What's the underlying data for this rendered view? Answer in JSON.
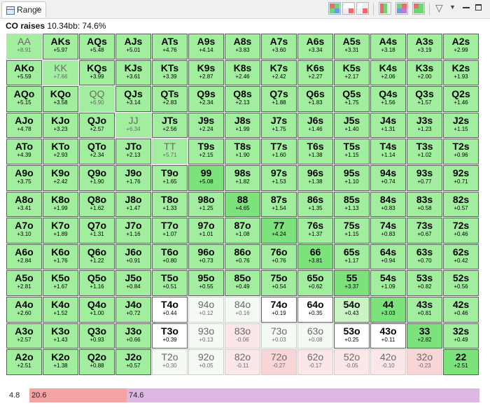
{
  "tab": {
    "label": "Range",
    "close": "×"
  },
  "toolbar": {
    "icons": [
      "layout-grid-icon",
      "layout-split-icon",
      "layout-quad-icon",
      "chart-color-icon",
      "heatmap-icon",
      "table-grid-icon"
    ],
    "filter_icon": "filter-icon"
  },
  "caption": {
    "prefix": "CO raises",
    "detail": "10.34bb: 74.6%"
  },
  "colors": {
    "green_strong": "#7ce37c",
    "green": "#a0ee9e",
    "green_light": "#c9f5c5",
    "pale": "#f3fbf2",
    "white": "#ffffff",
    "pink_light": "#fbe7e7",
    "pink": "#f8d6d6"
  },
  "matrix": [
    [
      [
        "AA",
        "+8.91",
        "g2",
        1
      ],
      [
        "AKs",
        "+5.97",
        "g2",
        0
      ],
      [
        "AQs",
        "+5.48",
        "g2",
        0
      ],
      [
        "AJs",
        "+5.01",
        "g2",
        0
      ],
      [
        "ATs",
        "+4.76",
        "g2",
        0
      ],
      [
        "A9s",
        "+4.14",
        "g2",
        0
      ],
      [
        "A8s",
        "+3.83",
        "g2",
        0
      ],
      [
        "A7s",
        "+3.60",
        "g2",
        0
      ],
      [
        "A6s",
        "+3.34",
        "g2",
        0
      ],
      [
        "A5s",
        "+3.31",
        "g2",
        0
      ],
      [
        "A4s",
        "+3.18",
        "g2",
        0
      ],
      [
        "A3s",
        "+3.19",
        "g2",
        0
      ],
      [
        "A2s",
        "+2.99",
        "g2",
        0
      ]
    ],
    [
      [
        "AKo",
        "+5.59",
        "g2",
        0
      ],
      [
        "KK",
        "+7.66",
        "g2",
        1
      ],
      [
        "KQs",
        "+3.99",
        "g2",
        0
      ],
      [
        "KJs",
        "+3.61",
        "g2",
        0
      ],
      [
        "KTs",
        "+3.39",
        "g2",
        0
      ],
      [
        "K9s",
        "+2.87",
        "g2",
        0
      ],
      [
        "K8s",
        "+2.46",
        "g2",
        0
      ],
      [
        "K7s",
        "+2.42",
        "g2",
        0
      ],
      [
        "K6s",
        "+2.27",
        "g2",
        0
      ],
      [
        "K5s",
        "+2.17",
        "g2",
        0
      ],
      [
        "K4s",
        "+2.06",
        "g2",
        0
      ],
      [
        "K3s",
        "+2.00",
        "g2",
        0
      ],
      [
        "K2s",
        "+1.93",
        "g2",
        0
      ]
    ],
    [
      [
        "AQo",
        "+5.15",
        "g2",
        0
      ],
      [
        "KQo",
        "+3.58",
        "g2",
        0
      ],
      [
        "QQ",
        "+6.90",
        "g2",
        1
      ],
      [
        "QJs",
        "+3.14",
        "g2",
        0
      ],
      [
        "QTs",
        "+2.83",
        "g2",
        0
      ],
      [
        "Q9s",
        "+2.34",
        "g2",
        0
      ],
      [
        "Q8s",
        "+2.13",
        "g2",
        0
      ],
      [
        "Q7s",
        "+1.88",
        "g2",
        0
      ],
      [
        "Q6s",
        "+1.83",
        "g2",
        0
      ],
      [
        "Q5s",
        "+1.75",
        "g2",
        0
      ],
      [
        "Q4s",
        "+1.56",
        "g2",
        0
      ],
      [
        "Q3s",
        "+1.57",
        "g2",
        0
      ],
      [
        "Q2s",
        "+1.46",
        "g2",
        0
      ]
    ],
    [
      [
        "AJo",
        "+4.78",
        "g2",
        0
      ],
      [
        "KJo",
        "+3.23",
        "g2",
        0
      ],
      [
        "QJo",
        "+2.57",
        "g2",
        0
      ],
      [
        "JJ",
        "+6.34",
        "g2",
        1
      ],
      [
        "JTs",
        "+2.56",
        "g2",
        0
      ],
      [
        "J9s",
        "+2.24",
        "g2",
        0
      ],
      [
        "J8s",
        "+1.99",
        "g2",
        0
      ],
      [
        "J7s",
        "+1.75",
        "g2",
        0
      ],
      [
        "J6s",
        "+1.46",
        "g2",
        0
      ],
      [
        "J5s",
        "+1.40",
        "g2",
        0
      ],
      [
        "J4s",
        "+1.31",
        "g2",
        0
      ],
      [
        "J3s",
        "+1.23",
        "g2",
        0
      ],
      [
        "J2s",
        "+1.15",
        "g2",
        0
      ]
    ],
    [
      [
        "ATo",
        "+4.39",
        "g2",
        0
      ],
      [
        "KTo",
        "+2.93",
        "g2",
        0
      ],
      [
        "QTo",
        "+2.34",
        "g2",
        0
      ],
      [
        "JTo",
        "+2.13",
        "g2",
        0
      ],
      [
        "TT",
        "+5.71",
        "g2",
        1
      ],
      [
        "T9s",
        "+2.15",
        "g2",
        0
      ],
      [
        "T8s",
        "+1.90",
        "g2",
        0
      ],
      [
        "T7s",
        "+1.60",
        "g2",
        0
      ],
      [
        "T6s",
        "+1.38",
        "g2",
        0
      ],
      [
        "T5s",
        "+1.15",
        "g2",
        0
      ],
      [
        "T4s",
        "+1.14",
        "g2",
        0
      ],
      [
        "T3s",
        "+1.02",
        "g2",
        0
      ],
      [
        "T2s",
        "+0.96",
        "g2",
        0
      ]
    ],
    [
      [
        "A9o",
        "+3.75",
        "g2",
        0
      ],
      [
        "K9o",
        "+2.42",
        "g2",
        0
      ],
      [
        "Q9o",
        "+1.90",
        "g2",
        0
      ],
      [
        "J9o",
        "+1.76",
        "g2",
        0
      ],
      [
        "T9o",
        "+1.65",
        "g2",
        0
      ],
      [
        "99",
        "+5.08",
        "g1",
        0
      ],
      [
        "98s",
        "+1.82",
        "g2",
        0
      ],
      [
        "97s",
        "+1.53",
        "g2",
        0
      ],
      [
        "96s",
        "+1.38",
        "g2",
        0
      ],
      [
        "95s",
        "+1.10",
        "g2",
        0
      ],
      [
        "94s",
        "+0.74",
        "g2",
        0
      ],
      [
        "93s",
        "+0.77",
        "g2",
        0
      ],
      [
        "92s",
        "+0.71",
        "g2",
        0
      ]
    ],
    [
      [
        "A8o",
        "+3.41",
        "g2",
        0
      ],
      [
        "K8o",
        "+1.99",
        "g2",
        0
      ],
      [
        "Q8o",
        "+1.62",
        "g2",
        0
      ],
      [
        "J8o",
        "+1.47",
        "g2",
        0
      ],
      [
        "T8o",
        "+1.33",
        "g2",
        0
      ],
      [
        "98o",
        "+1.25",
        "g2",
        0
      ],
      [
        "88",
        "+4.65",
        "g1",
        0
      ],
      [
        "87s",
        "+1.54",
        "g2",
        0
      ],
      [
        "86s",
        "+1.35",
        "g2",
        0
      ],
      [
        "85s",
        "+1.13",
        "g2",
        0
      ],
      [
        "84s",
        "+0.83",
        "g2",
        0
      ],
      [
        "83s",
        "+0.58",
        "g2",
        0
      ],
      [
        "82s",
        "+0.57",
        "g2",
        0
      ]
    ],
    [
      [
        "A7o",
        "+3.10",
        "g2",
        0
      ],
      [
        "K7o",
        "+1.89",
        "g2",
        0
      ],
      [
        "Q7o",
        "+1.31",
        "g2",
        0
      ],
      [
        "J7o",
        "+1.16",
        "g2",
        0
      ],
      [
        "T7o",
        "+1.07",
        "g2",
        0
      ],
      [
        "97o",
        "+1.01",
        "g2",
        0
      ],
      [
        "87o",
        "+1.08",
        "g2",
        0
      ],
      [
        "77",
        "+4.24",
        "g1",
        0
      ],
      [
        "76s",
        "+1.37",
        "g2",
        0
      ],
      [
        "75s",
        "+1.15",
        "g2",
        0
      ],
      [
        "74s",
        "+0.83",
        "g2",
        0
      ],
      [
        "73s",
        "+0.67",
        "g2",
        0
      ],
      [
        "72s",
        "+0.46",
        "g2",
        0
      ]
    ],
    [
      [
        "A6o",
        "+2.84",
        "g2",
        0
      ],
      [
        "K6o",
        "+1.76",
        "g2",
        0
      ],
      [
        "Q6o",
        "+1.22",
        "g2",
        0
      ],
      [
        "J6o",
        "+0.91",
        "g2",
        0
      ],
      [
        "T6o",
        "+0.80",
        "g2",
        0
      ],
      [
        "96o",
        "+0.73",
        "g2",
        0
      ],
      [
        "86o",
        "+0.76",
        "g2",
        0
      ],
      [
        "76o",
        "+0.76",
        "g2",
        0
      ],
      [
        "66",
        "+3.81",
        "g1",
        0
      ],
      [
        "65s",
        "+1.17",
        "g2",
        0
      ],
      [
        "64s",
        "+0.94",
        "g2",
        0
      ],
      [
        "63s",
        "+0.70",
        "g2",
        0
      ],
      [
        "62s",
        "+0.42",
        "g2",
        0
      ]
    ],
    [
      [
        "A5o",
        "+2.81",
        "g2",
        0
      ],
      [
        "K5o",
        "+1.67",
        "g2",
        0
      ],
      [
        "Q5o",
        "+1.16",
        "g2",
        0
      ],
      [
        "J5o",
        "+0.84",
        "g2",
        0
      ],
      [
        "T5o",
        "+0.51",
        "g2",
        0
      ],
      [
        "95o",
        "+0.55",
        "g2",
        0
      ],
      [
        "85o",
        "+0.49",
        "g2",
        0
      ],
      [
        "75o",
        "+0.54",
        "g2",
        0
      ],
      [
        "65o",
        "+0.62",
        "g2",
        0
      ],
      [
        "55",
        "+3.37",
        "g1",
        0
      ],
      [
        "54s",
        "+1.09",
        "g2",
        0
      ],
      [
        "53s",
        "+0.82",
        "g2",
        0
      ],
      [
        "52s",
        "+0.56",
        "g2",
        0
      ]
    ],
    [
      [
        "A4o",
        "+2.60",
        "g2",
        0
      ],
      [
        "K4o",
        "+1.52",
        "g2",
        0
      ],
      [
        "Q4o",
        "+1.00",
        "g2",
        0
      ],
      [
        "J4o",
        "+0.72",
        "g2",
        0
      ],
      [
        "T4o",
        "+0.44",
        "w",
        0
      ],
      [
        "94o",
        "+0.12",
        "p",
        1
      ],
      [
        "84o",
        "+0.16",
        "p",
        1
      ],
      [
        "74o",
        "+0.19",
        "w",
        0
      ],
      [
        "64o",
        "+0.35",
        "w",
        0
      ],
      [
        "54o",
        "+0.43",
        "g3",
        0
      ],
      [
        "44",
        "+3.03",
        "g1",
        0
      ],
      [
        "43s",
        "+0.81",
        "g2",
        0
      ],
      [
        "42s",
        "+0.46",
        "g2",
        0
      ]
    ],
    [
      [
        "A3o",
        "+2.57",
        "g2",
        0
      ],
      [
        "K3o",
        "+1.43",
        "g2",
        0
      ],
      [
        "Q3o",
        "+0.93",
        "g2",
        0
      ],
      [
        "J3o",
        "+0.66",
        "g2",
        0
      ],
      [
        "T3o",
        "+0.39",
        "w",
        0
      ],
      [
        "93o",
        "+0.13",
        "p",
        1
      ],
      [
        "83o",
        "-0.06",
        "k",
        1
      ],
      [
        "73o",
        "+0.03",
        "p",
        1
      ],
      [
        "63o",
        "+0.08",
        "p",
        1
      ],
      [
        "53o",
        "+0.25",
        "w",
        0
      ],
      [
        "43o",
        "+0.11",
        "w",
        0
      ],
      [
        "33",
        "+2.82",
        "g1",
        0
      ],
      [
        "32s",
        "+0.49",
        "g2",
        0
      ]
    ],
    [
      [
        "A2o",
        "+2.51",
        "g2",
        0
      ],
      [
        "K2o",
        "+1.38",
        "g2",
        0
      ],
      [
        "Q2o",
        "+0.88",
        "g2",
        0
      ],
      [
        "J2o",
        "+0.57",
        "g2",
        0
      ],
      [
        "T2o",
        "+0.30",
        "p",
        1
      ],
      [
        "92o",
        "+0.05",
        "p",
        1
      ],
      [
        "82o",
        "-0.11",
        "k",
        1
      ],
      [
        "72o",
        "-0.27",
        "k2",
        1
      ],
      [
        "62o",
        "-0.17",
        "k",
        1
      ],
      [
        "52o",
        "-0.05",
        "k",
        1
      ],
      [
        "42o",
        "-0.10",
        "k",
        1
      ],
      [
        "32o",
        "-0.23",
        "k2",
        1
      ],
      [
        "22",
        "+2.51",
        "g1",
        0
      ]
    ]
  ],
  "legend_bar": {
    "segments": [
      {
        "label": "4.8",
        "color": "#ffffff",
        "fraction": 0.048
      },
      {
        "label": "20.6",
        "color": "#f4a3a3",
        "fraction": 0.206
      },
      {
        "label": "74.6",
        "color": "#deb8e2",
        "fraction": 0.746
      }
    ]
  }
}
